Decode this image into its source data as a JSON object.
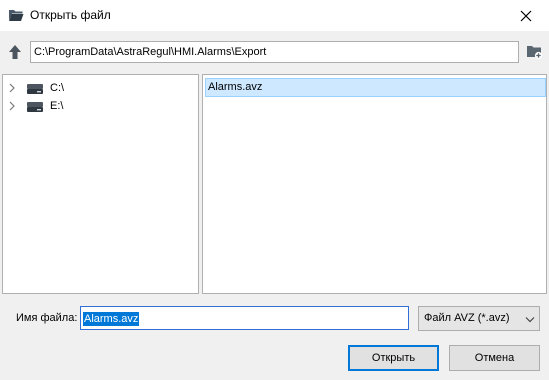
{
  "window": {
    "title": "Открыть файл",
    "icon": "folder-open-icon"
  },
  "toolbar": {
    "path": "C:\\ProgramData\\AstraRegul\\HMI.Alarms\\Export",
    "up_icon": "arrow-up-icon",
    "new_folder_icon": "new-folder-icon"
  },
  "tree": {
    "items": [
      {
        "label": "C:\\",
        "icon": "drive-icon"
      },
      {
        "label": "E:\\",
        "icon": "drive-icon"
      }
    ]
  },
  "files": {
    "items": [
      {
        "label": "Alarms.avz",
        "selected": true
      }
    ]
  },
  "filename": {
    "label": "Имя файла:",
    "value": "Alarms.avz"
  },
  "filetype": {
    "selected": "Файл AVZ (*.avz)"
  },
  "buttons": {
    "open": "Открыть",
    "cancel": "Отмена"
  },
  "colors": {
    "selection": "#cde8ff",
    "accent": "#0078d7"
  }
}
